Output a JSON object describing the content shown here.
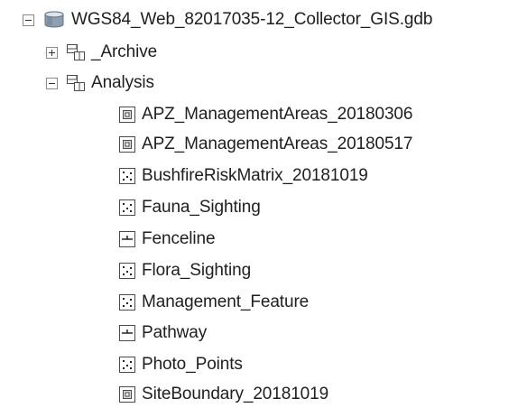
{
  "tree": {
    "gdb": {
      "label": "WGS84_Web_82017035-12_Collector_GIS.gdb",
      "icon": "geodatabase-icon",
      "expanded": true
    },
    "datasets": [
      {
        "label": "_Archive",
        "icon": "feature-dataset-icon",
        "expanded": false
      },
      {
        "label": "Analysis",
        "icon": "feature-dataset-icon",
        "expanded": true,
        "children": [
          {
            "label": "APZ_ManagementAreas_20180306",
            "icon": "polygon-feature-class-icon"
          },
          {
            "label": "APZ_ManagementAreas_20180517",
            "icon": "polygon-feature-class-icon"
          },
          {
            "label": "BushfireRiskMatrix_20181019",
            "icon": "point-feature-class-icon"
          },
          {
            "label": "Fauna_Sighting",
            "icon": "point-feature-class-icon"
          },
          {
            "label": "Fenceline",
            "icon": "line-feature-class-icon"
          },
          {
            "label": "Flora_Sighting",
            "icon": "point-feature-class-icon"
          },
          {
            "label": "Management_Feature",
            "icon": "point-feature-class-icon"
          },
          {
            "label": "Pathway",
            "icon": "line-feature-class-icon"
          },
          {
            "label": "Photo_Points",
            "icon": "point-feature-class-icon"
          },
          {
            "label": "SiteBoundary_20181019",
            "icon": "polygon-feature-class-icon"
          }
        ]
      }
    ]
  }
}
